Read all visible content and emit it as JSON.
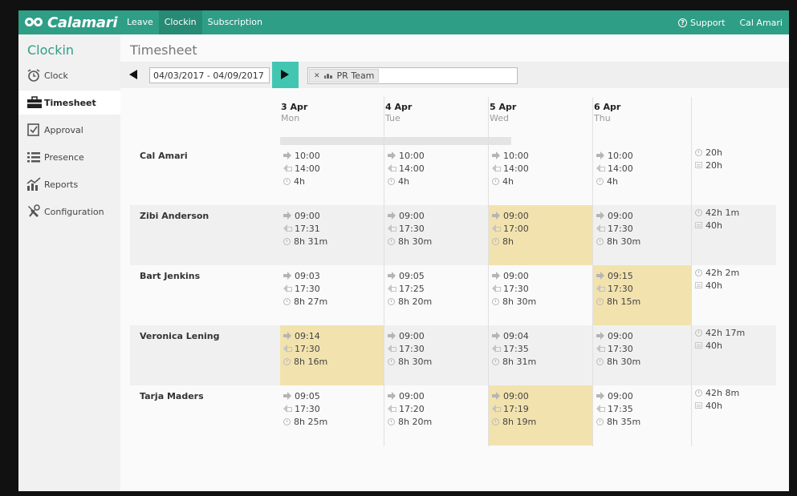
{
  "app": {
    "brand": "Calamari"
  },
  "nav": {
    "items": [
      "Leave",
      "Clockin",
      "Subscription"
    ],
    "active": 1
  },
  "header_right": {
    "support": "Support",
    "user": "Cal Amari"
  },
  "sidebar": {
    "title": "Clockin",
    "items": [
      {
        "label": "Clock",
        "icon": "alarm-clock-icon"
      },
      {
        "label": "Timesheet",
        "icon": "briefcase-icon"
      },
      {
        "label": "Approval",
        "icon": "checkbox-icon"
      },
      {
        "label": "Presence",
        "icon": "list-icon"
      },
      {
        "label": "Reports",
        "icon": "chart-icon"
      },
      {
        "label": "Configuration",
        "icon": "wrench-icon"
      }
    ],
    "active": 1
  },
  "main": {
    "title": "Timesheet",
    "date_range": "04/03/2017 - 04/09/2017",
    "team_tag": "PR Team"
  },
  "days": [
    {
      "date": "3 Apr",
      "weekday": "Mon"
    },
    {
      "date": "4 Apr",
      "weekday": "Tue"
    },
    {
      "date": "5 Apr",
      "weekday": "Wed"
    },
    {
      "date": "6 Apr",
      "weekday": "Thu"
    }
  ],
  "rows": [
    {
      "name": "Cal Amari",
      "cells": [
        {
          "in": "10:00",
          "out": "14:00",
          "dur": "4h",
          "hl": false
        },
        {
          "in": "10:00",
          "out": "14:00",
          "dur": "4h",
          "hl": false
        },
        {
          "in": "10:00",
          "out": "14:00",
          "dur": "4h",
          "hl": false
        },
        {
          "in": "10:00",
          "out": "14:00",
          "dur": "4h",
          "hl": false
        }
      ],
      "total": "20h",
      "expected": "20h"
    },
    {
      "name": "Zibi Anderson",
      "cells": [
        {
          "in": "09:00",
          "out": "17:31",
          "dur": "8h 31m",
          "hl": false
        },
        {
          "in": "09:00",
          "out": "17:30",
          "dur": "8h 30m",
          "hl": false
        },
        {
          "in": "09:00",
          "out": "17:00",
          "dur": "8h",
          "hl": true
        },
        {
          "in": "09:00",
          "out": "17:30",
          "dur": "8h 30m",
          "hl": false
        }
      ],
      "total": "42h 1m",
      "expected": "40h"
    },
    {
      "name": "Bart Jenkins",
      "cells": [
        {
          "in": "09:03",
          "out": "17:30",
          "dur": "8h 27m",
          "hl": false
        },
        {
          "in": "09:05",
          "out": "17:25",
          "dur": "8h 20m",
          "hl": false
        },
        {
          "in": "09:00",
          "out": "17:30",
          "dur": "8h 30m",
          "hl": false
        },
        {
          "in": "09:15",
          "out": "17:30",
          "dur": "8h 15m",
          "hl": true
        }
      ],
      "total": "42h 2m",
      "expected": "40h"
    },
    {
      "name": "Veronica Lening",
      "cells": [
        {
          "in": "09:14",
          "out": "17:30",
          "dur": "8h 16m",
          "hl": true
        },
        {
          "in": "09:00",
          "out": "17:30",
          "dur": "8h 30m",
          "hl": false
        },
        {
          "in": "09:04",
          "out": "17:35",
          "dur": "8h 31m",
          "hl": false
        },
        {
          "in": "09:00",
          "out": "17:30",
          "dur": "8h 30m",
          "hl": false
        }
      ],
      "total": "42h 17m",
      "expected": "40h"
    },
    {
      "name": "Tarja Maders",
      "cells": [
        {
          "in": "09:05",
          "out": "17:30",
          "dur": "8h 25m",
          "hl": false
        },
        {
          "in": "09:00",
          "out": "17:20",
          "dur": "8h 20m",
          "hl": false
        },
        {
          "in": "09:00",
          "out": "17:19",
          "dur": "8h 19m",
          "hl": true
        },
        {
          "in": "09:00",
          "out": "17:35",
          "dur": "8h 35m",
          "hl": false
        }
      ],
      "total": "42h 8m",
      "expected": "40h"
    }
  ],
  "colors": {
    "brand": "#2f9e86",
    "accent": "#42c6b2",
    "highlight": "#f2e2ae"
  }
}
